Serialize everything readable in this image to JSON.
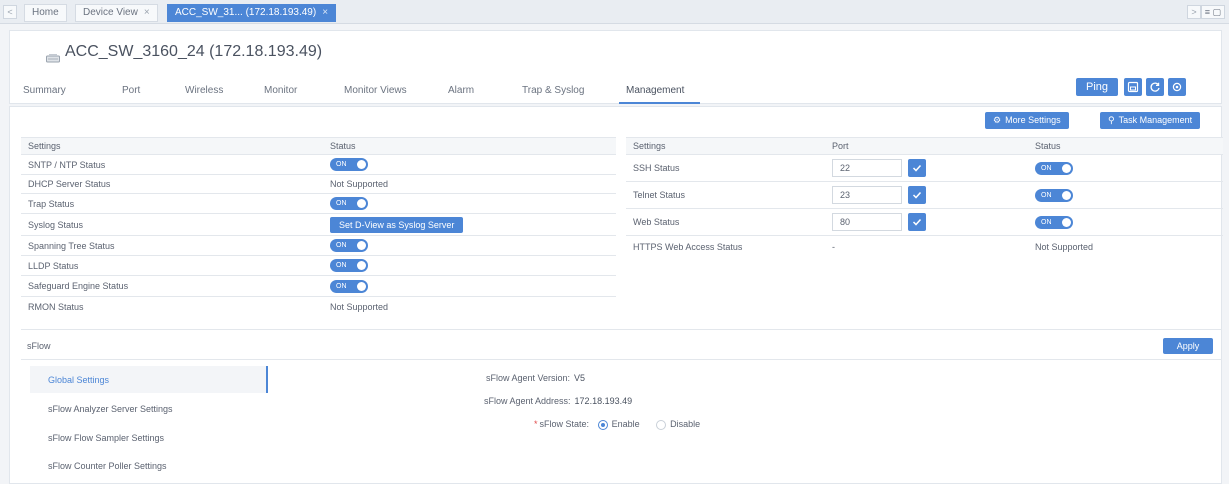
{
  "tabs": {
    "items": [
      {
        "label": "Home"
      },
      {
        "label": "Device View",
        "close": "×"
      },
      {
        "label": "ACC_SW_31... (172.18.193.49)",
        "close": "×"
      }
    ],
    "prev_glyph": "<",
    "next_glyph": ">",
    "right_glyphs": "≡ ▢"
  },
  "header": {
    "device_title": "ACC_SW_3160_24 (172.18.193.49)",
    "nav": [
      "Summary",
      "Port",
      "Wireless",
      "Monitor",
      "Monitor Views",
      "Alarm",
      "Trap & Syslog",
      "Management"
    ],
    "active_nav": "Management",
    "ping_label": "Ping",
    "icon_buttons": [
      "save-icon",
      "refresh-icon",
      "settings-icon"
    ]
  },
  "actions": {
    "more_settings": "More Settings",
    "task_management": "Task Management"
  },
  "left_table": {
    "headers": [
      "Settings",
      "Status"
    ],
    "rows": [
      {
        "setting": "SNTP / NTP Status",
        "status": "ON",
        "kind": "toggle"
      },
      {
        "setting": "DHCP Server Status",
        "status": "Not Supported",
        "kind": "text"
      },
      {
        "setting": "Trap Status",
        "status": "ON",
        "kind": "toggle"
      },
      {
        "setting": "Syslog Status",
        "status": "Set D-View as Syslog Server",
        "kind": "button"
      },
      {
        "setting": "Spanning Tree Status",
        "status": "ON",
        "kind": "toggle"
      },
      {
        "setting": "LLDP Status",
        "status": "ON",
        "kind": "toggle"
      },
      {
        "setting": "Safeguard Engine Status",
        "status": "ON",
        "kind": "toggle"
      },
      {
        "setting": "RMON Status",
        "status": "Not Supported",
        "kind": "text"
      }
    ]
  },
  "right_table": {
    "headers": [
      "Settings",
      "Port",
      "Status"
    ],
    "rows": [
      {
        "setting": "SSH Status",
        "port": "22",
        "status": "ON"
      },
      {
        "setting": "Telnet Status",
        "port": "23",
        "status": "ON"
      },
      {
        "setting": "Web Status",
        "port": "80",
        "status": "ON"
      },
      {
        "setting": "HTTPS Web Access Status",
        "port": "-",
        "status": "Not Supported"
      }
    ]
  },
  "sflow": {
    "title": "sFlow",
    "apply_label": "Apply",
    "menu": [
      "Global Settings",
      "sFlow Analyzer Server Settings",
      "sFlow Flow Sampler Settings",
      "sFlow Counter Poller Settings"
    ],
    "active_menu": "Global Settings",
    "agent_version_label": "sFlow Agent Version:",
    "agent_version": "V5",
    "agent_address_label": "sFlow Agent Address:",
    "agent_address": "172.18.193.49",
    "state_label": "sFlow State:",
    "state_required_mark": "*",
    "state_options": [
      "Enable",
      "Disable"
    ],
    "state_selected": "Enable"
  },
  "colors": {
    "accent": "#4c86d6",
    "required": "#e04a4a"
  }
}
